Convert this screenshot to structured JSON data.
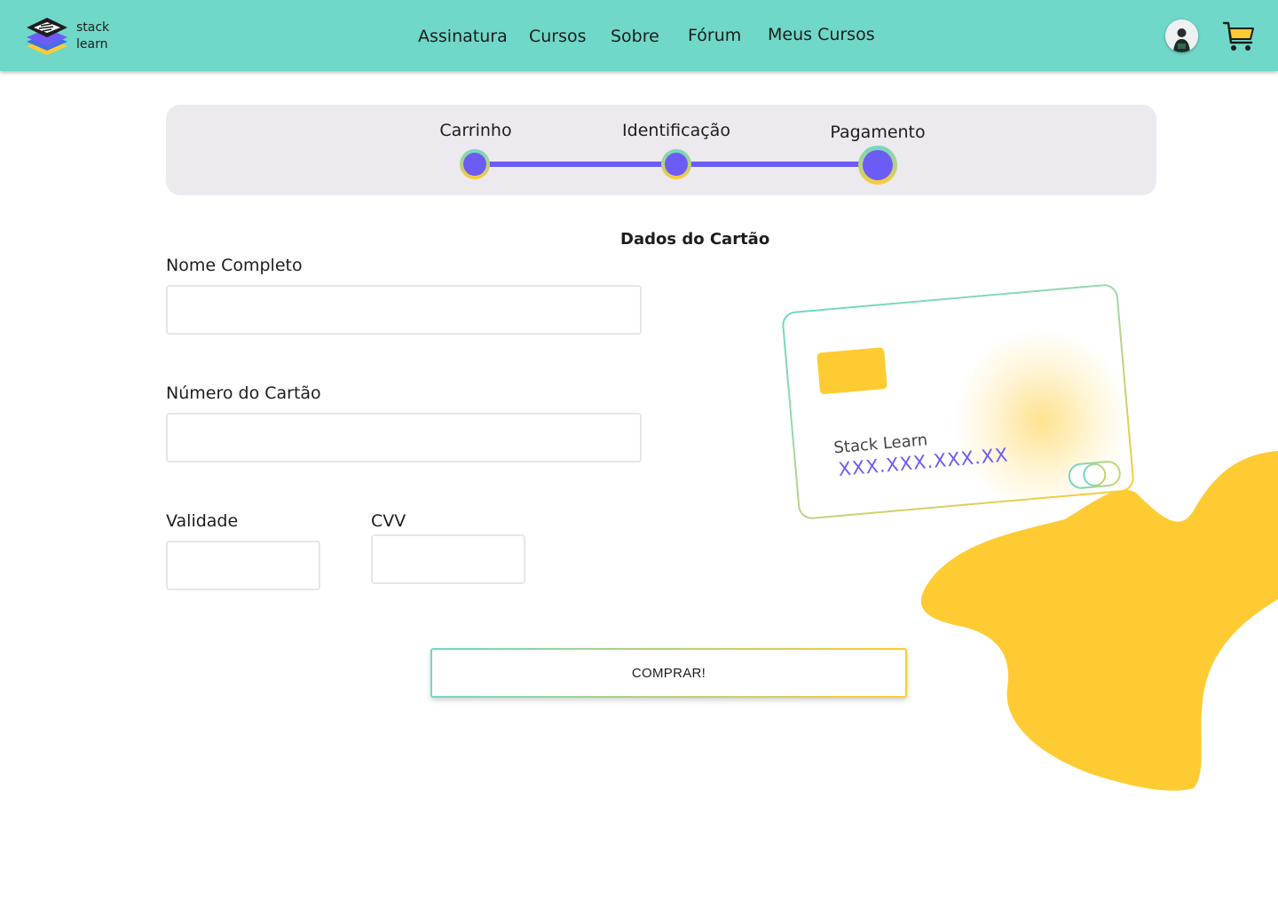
{
  "brand": {
    "line1": "stack",
    "line2": "learn",
    "logo_icon": "stacked-layers-logo-icon",
    "colors": {
      "teal": "#70D8C8",
      "purple": "#6C5CF6",
      "yellow": "#FECB33",
      "blue": "#3F6FE0"
    }
  },
  "nav": {
    "items": [
      {
        "label": "Assinatura"
      },
      {
        "label": "Cursos"
      },
      {
        "label": "Sobre"
      },
      {
        "label": "Fórum"
      },
      {
        "label": "Meus Cursos"
      }
    ],
    "avatar_icon": "user-avatar-icon",
    "cart_icon": "shopping-cart-icon"
  },
  "stepper": {
    "steps": [
      {
        "label": "Carrinho"
      },
      {
        "label": "Identificação"
      },
      {
        "label": "Pagamento"
      }
    ],
    "current_step": 3
  },
  "form": {
    "title": "Dados do Cartão",
    "name_label": "Nome Completo",
    "name_value": "",
    "number_label": "Número do Cartão",
    "number_value": "",
    "expiry_label": "Validade",
    "expiry_value": "",
    "cvv_label": "CVV",
    "cvv_value": "",
    "submit_label": "COMPRAR!"
  },
  "card": {
    "holder": "Stack Learn",
    "number": "XXX.XXX.XXX.XX"
  }
}
